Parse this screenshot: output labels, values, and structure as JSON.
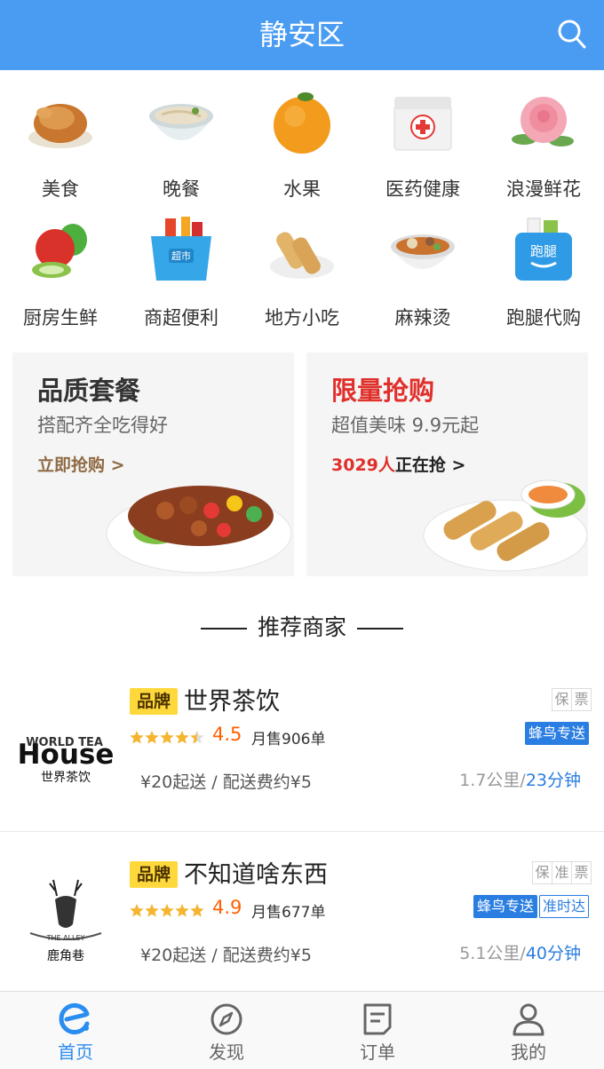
{
  "header": {
    "title": "静安区"
  },
  "categories": [
    {
      "label": "美食",
      "icon": "roast-chicken-icon"
    },
    {
      "label": "晚餐",
      "icon": "noodle-bowl-icon"
    },
    {
      "label": "水果",
      "icon": "orange-icon"
    },
    {
      "label": "医药健康",
      "icon": "medicine-box-icon"
    },
    {
      "label": "浪漫鲜花",
      "icon": "rose-icon"
    },
    {
      "label": "厨房生鲜",
      "icon": "vegetables-icon"
    },
    {
      "label": "商超便利",
      "icon": "supermarket-basket-icon"
    },
    {
      "label": "地方小吃",
      "icon": "spring-roll-icon"
    },
    {
      "label": "麻辣烫",
      "icon": "spicy-hotpot-icon"
    },
    {
      "label": "跑腿代购",
      "icon": "errand-bag-icon"
    }
  ],
  "promos": [
    {
      "title": "品质套餐",
      "subtitle": "搭配齐全吃得好",
      "link": "立即抢购 >",
      "title_color": "#333333"
    },
    {
      "title": "限量抢购",
      "subtitle": "超值美味 9.9元起",
      "count": "3029人",
      "link_suffix": "正在抢 >",
      "title_color": "#e0302c"
    }
  ],
  "section": {
    "title": "推荐商家"
  },
  "shops": [
    {
      "brand_badge": "品牌",
      "name": "世界茶饮",
      "logo_text_top": "WORLD TEA",
      "logo_text_main": "House",
      "logo_text_cn": "世界茶饮",
      "tags": [
        "保",
        "票"
      ],
      "stars": 4.5,
      "rating": "4.5",
      "sales": "月售906单",
      "services": [
        "蜂鸟专送"
      ],
      "fee": "¥20起送 / 配送费约¥5",
      "distance": "1.7公里",
      "time": "23分钟"
    },
    {
      "brand_badge": "品牌",
      "name": "不知道啥东西",
      "logo_text_cn": "鹿角巷",
      "logo_text_ribbon": "THE ALLEY",
      "tags": [
        "保",
        "准",
        "票"
      ],
      "stars": 4.9,
      "rating": "4.9",
      "sales": "月售677单",
      "services": [
        "蜂鸟专送",
        "准时达"
      ],
      "fee": "¥20起送 / 配送费约¥5",
      "distance": "5.1公里",
      "time": "40分钟"
    }
  ],
  "tabbar": [
    {
      "label": "首页",
      "icon": "home-e-icon",
      "active": true
    },
    {
      "label": "发现",
      "icon": "compass-icon",
      "active": false
    },
    {
      "label": "订单",
      "icon": "order-list-icon",
      "active": false
    },
    {
      "label": "我的",
      "icon": "profile-icon",
      "active": false
    }
  ],
  "colors": {
    "header": "#4a9cf3",
    "accent_blue": "#2a7de1",
    "rating": "#ff6000",
    "brand_badge": "#ffd93c",
    "promo_red": "#e0302c"
  }
}
